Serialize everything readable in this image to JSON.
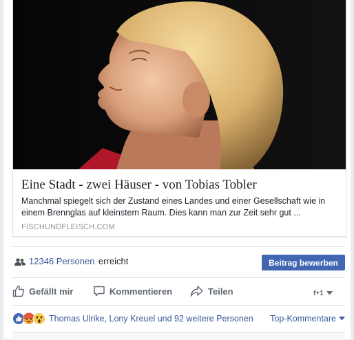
{
  "link_preview": {
    "title": "Eine Stadt - zwei Häuser - von Tobias Tobler",
    "description": "Manchmal spiegelt sich der Zustand eines Landes und einer Gesellschaft wie in einem Brennglas auf kleinstem Raum. Dies kann man zur Zeit sehr gut ...",
    "domain": "FISCHUNDFLEISCH.COM",
    "image_icon": "portrait-photo"
  },
  "reach": {
    "icon": "people-icon",
    "count_label": "12346 Personen",
    "suffix": "erreicht",
    "boost_button": "Beitrag bewerben"
  },
  "actions": {
    "like": "Gefällt mir",
    "comment": "Kommentieren",
    "share": "Teilen",
    "viewer_badge": "f+1"
  },
  "reactions": {
    "icons": [
      "like-reaction-icon",
      "angry-reaction-icon",
      "wow-reaction-icon"
    ],
    "names": "Thomas Ulrike, Lony Kreuel und 92 weitere Personen",
    "sort_label": "Top-Kommentare"
  },
  "colors": {
    "brand_blue": "#4267b2",
    "link_blue": "#365899",
    "text_gray": "#606770",
    "border": "#dddfe2"
  }
}
